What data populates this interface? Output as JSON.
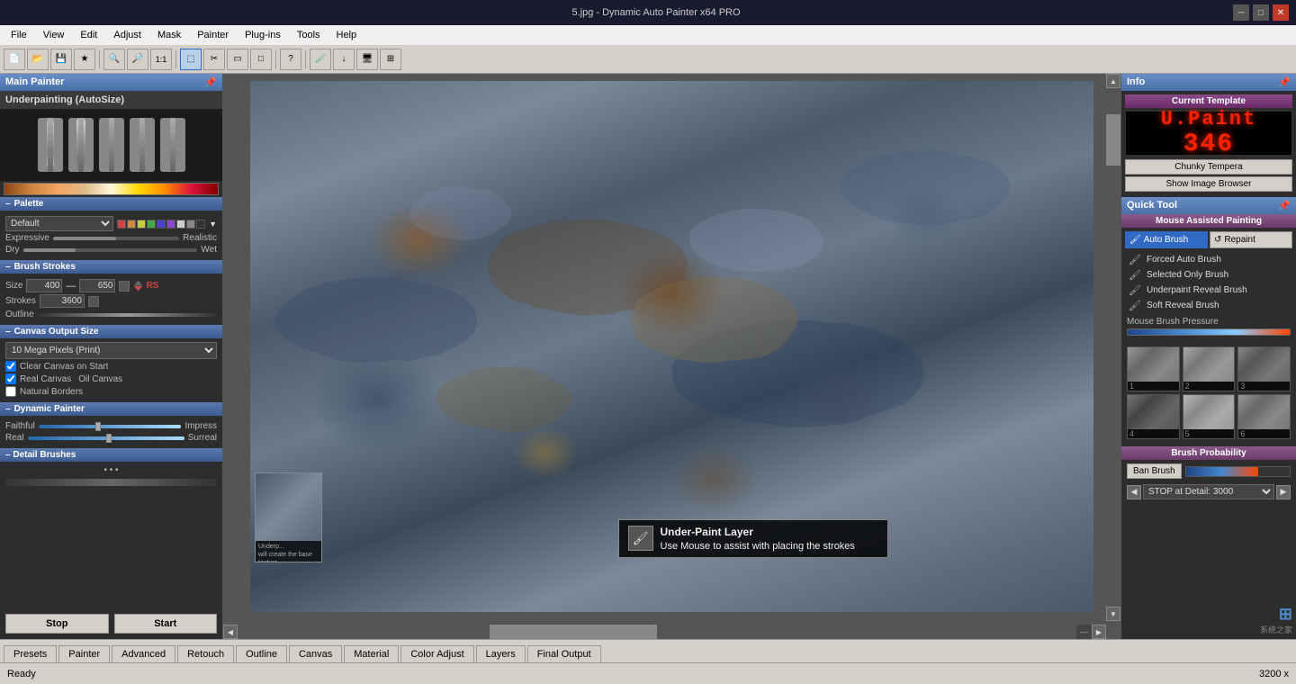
{
  "window": {
    "title": "5.jpg - Dynamic Auto Painter x64 PRO",
    "controls": {
      "minimize": "─",
      "maximize": "□",
      "close": "✕"
    }
  },
  "menu": {
    "items": [
      "File",
      "View",
      "Edit",
      "Adjust",
      "Mask",
      "Painter",
      "Plug-ins",
      "Tools",
      "Help"
    ]
  },
  "left_panel": {
    "title": "Main Painter",
    "preset_label": "Underpainting (AutoSize)",
    "sections": {
      "palette": {
        "label": "Palette",
        "default": "Default",
        "expressive": "Expressive",
        "realistic": "Realistic",
        "dry": "Dry",
        "wet": "Wet"
      },
      "brush_strokes": {
        "label": "Brush Strokes",
        "size_label": "Size",
        "size_min": "400",
        "size_max": "650",
        "strokes_label": "Strokes",
        "strokes_val": "3600",
        "outline_label": "Outline"
      },
      "canvas_output": {
        "label": "Canvas Output Size",
        "option": "10 Mega Pixels (Print)"
      },
      "clear_canvas": "Clear Canvas on Start",
      "real_canvas": "Real Canvas",
      "oil_canvas": "Oil Canvas",
      "natural_borders": "Natural Borders",
      "dynamic_painter": {
        "label": "Dynamic Painter",
        "faithful": "Faithful",
        "impress": "Impress",
        "real": "Real",
        "surreal": "Surreal"
      },
      "detail_brushes": {
        "label": "Detail Brushes"
      }
    },
    "buttons": {
      "stop": "Stop",
      "start": "Start"
    }
  },
  "right_panel": {
    "info_title": "Info",
    "current_template_label": "Current Template",
    "led_line1": "U.Paint",
    "led_line2": "346",
    "chunky_tempera": "Chunky Tempera",
    "show_image_browser": "Show Image Browser",
    "quick_tool_label": "Quick Tool",
    "mouse_assisted": "Mouse Assisted Painting",
    "auto_brush": "Auto Brush",
    "repaint": "Repaint",
    "forced_auto_brush": "Forced Auto Brush",
    "selected_only_brush": "Selected Only Brush",
    "underpaint_reveal": "Underpaint Reveal Brush",
    "soft_reveal": "Soft Reveal Brush",
    "mouse_brush_pressure": "Mouse Brush Pressure",
    "brush_probability": "Brush Probability",
    "ban_brush": "Ban Brush",
    "stop_at_detail": "STOP at Detail: 3000",
    "brush_nums": [
      "1",
      "2",
      "3",
      "4",
      "5",
      "6"
    ]
  },
  "canvas": {
    "tooltip_title": "Under-Paint Layer",
    "tooltip_text": "Use Mouse to assist with placing the strokes"
  },
  "bottom_tabs": {
    "tabs": [
      "Presets",
      "Painter",
      "Advanced",
      "Retouch",
      "Outline",
      "Canvas",
      "Material",
      "Color Adjust",
      "Layers",
      "Final Output"
    ]
  },
  "status": {
    "ready": "Ready",
    "dimensions": "3200 x",
    "watermark": "系统之家"
  }
}
